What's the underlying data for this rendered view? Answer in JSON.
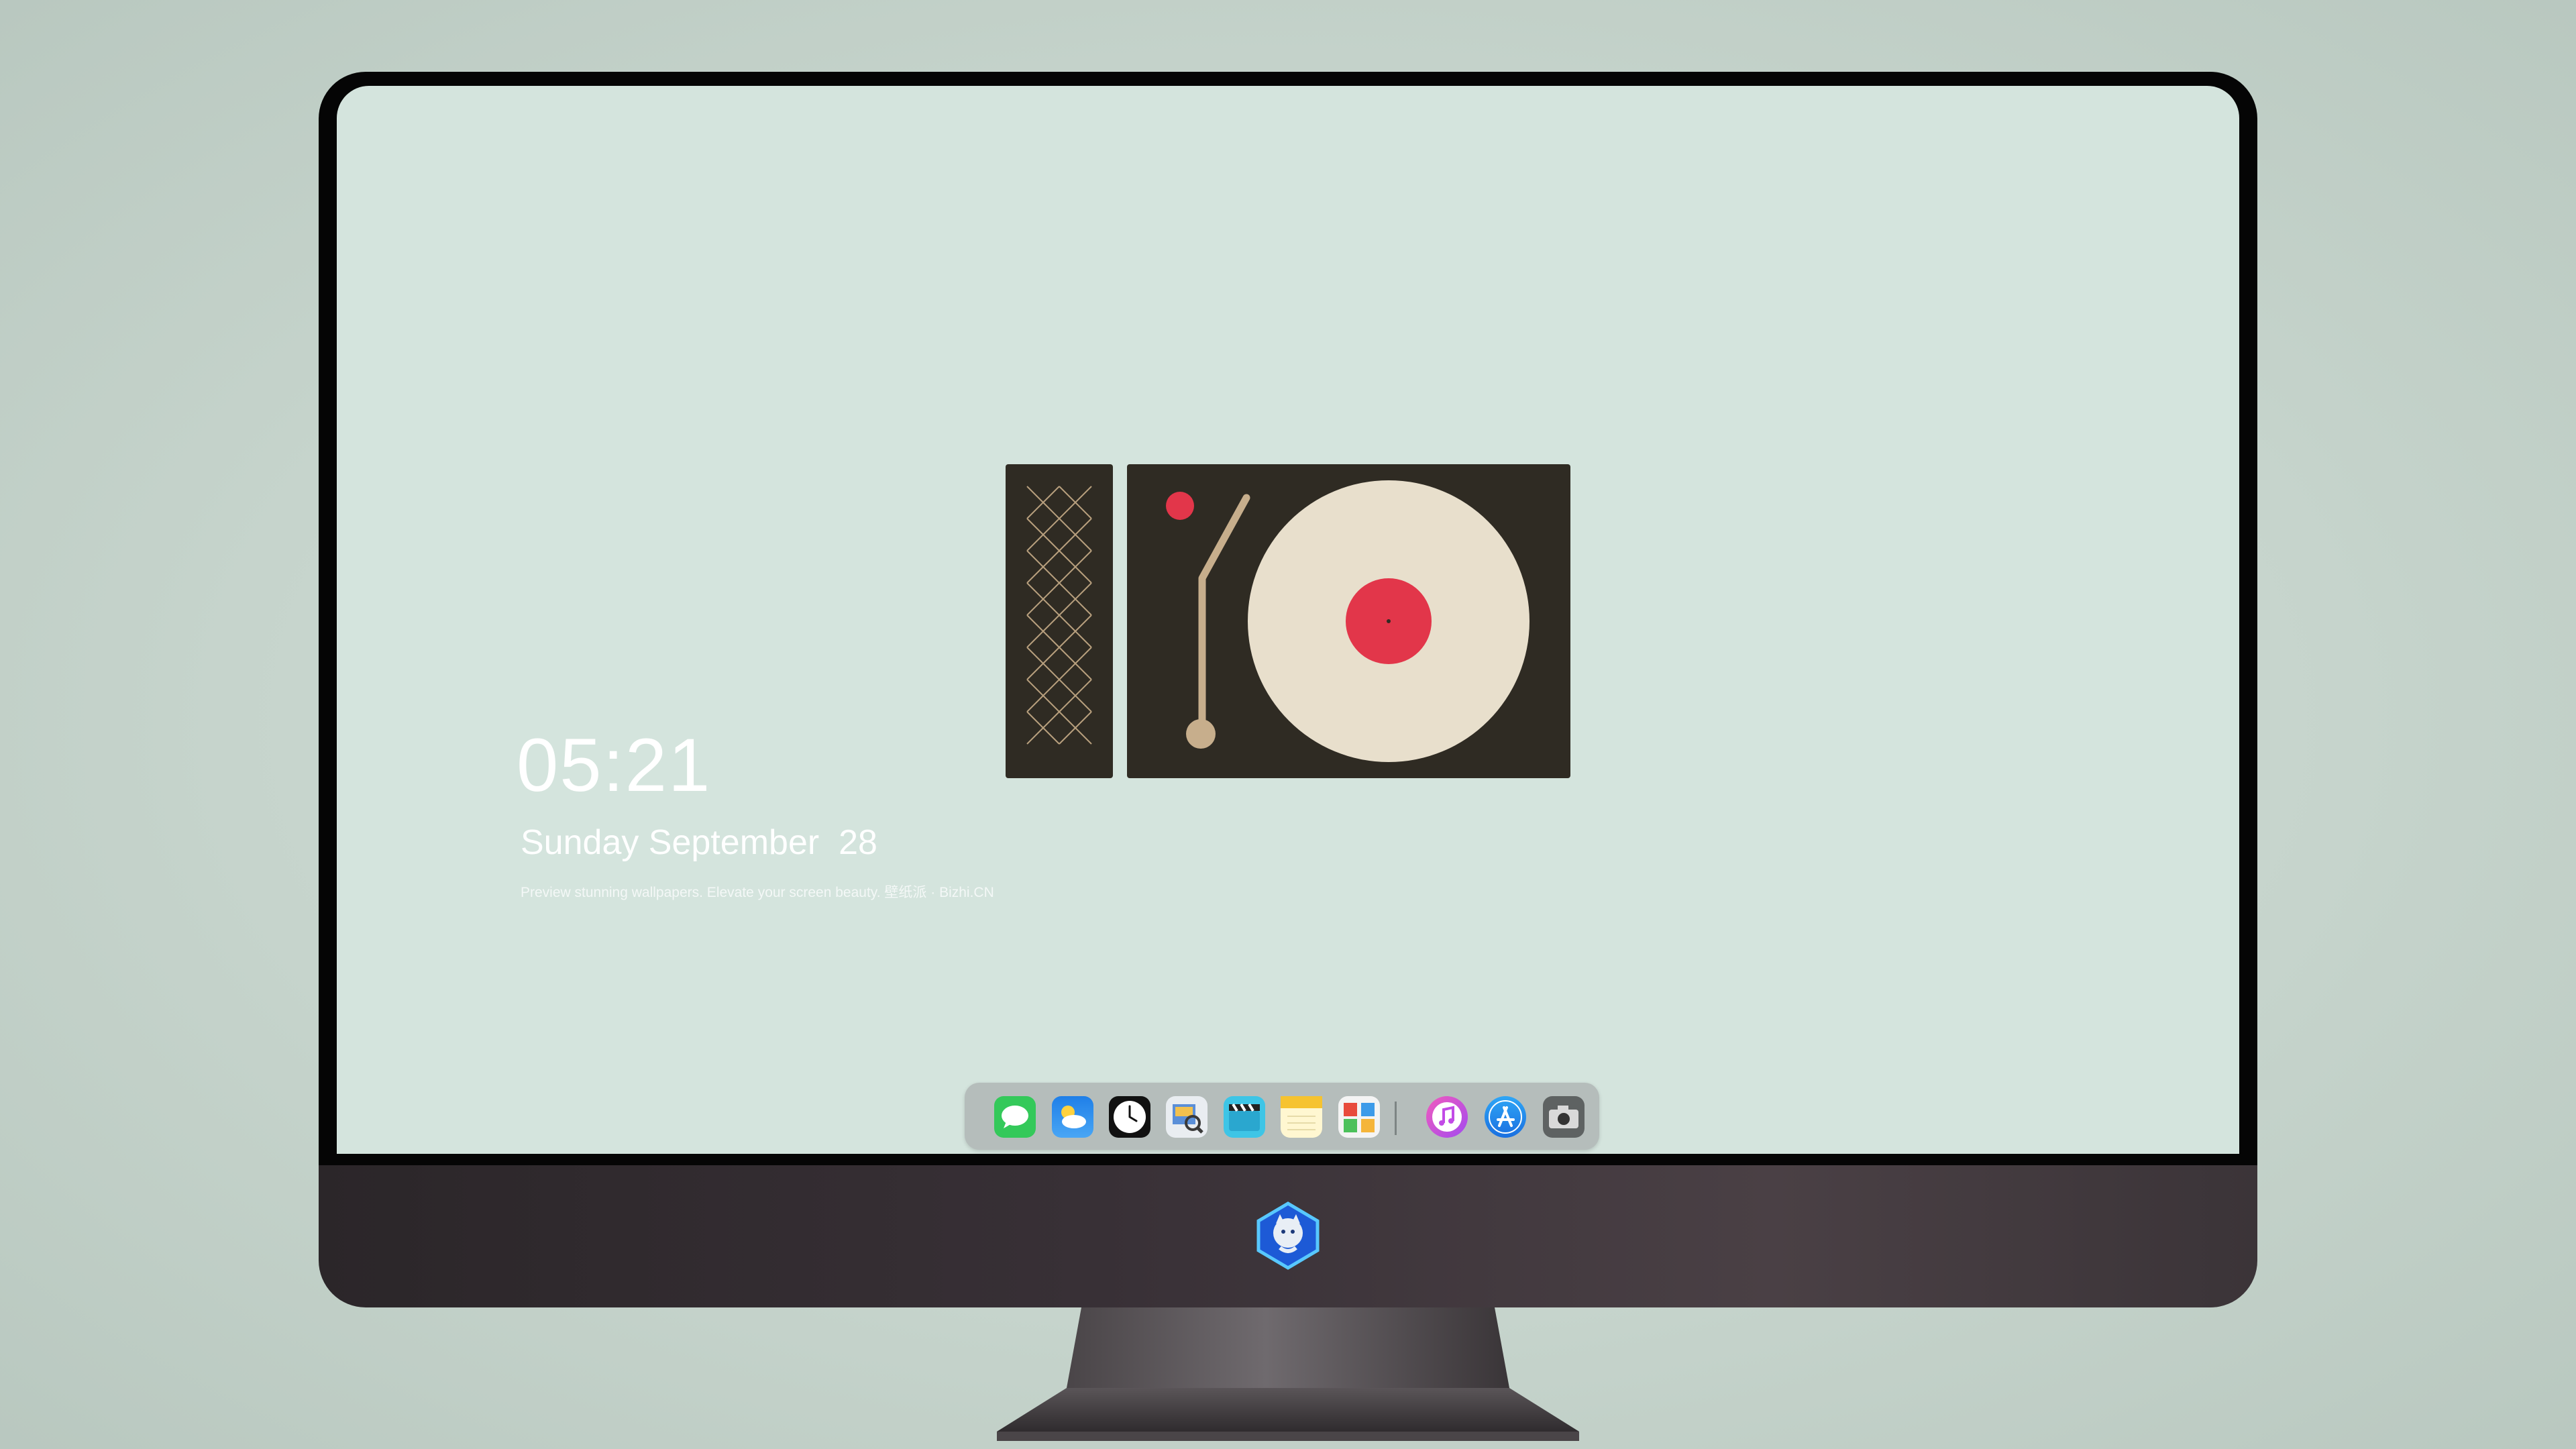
{
  "lockscreen": {
    "time": "05:21",
    "date": "Sunday September  28",
    "caption": "Preview stunning wallpapers. Elevate your screen beauty. 壁纸派 · Bizhi.CN"
  },
  "colors": {
    "background": "#c7d5cd",
    "screen": "#d4e4dd",
    "turntable_body": "#2f2b23",
    "record": "#e8dfcc",
    "record_label": "#e2364a",
    "tonearm": "#c7ae8c",
    "dock": "#b5bdbb"
  },
  "dock": {
    "apps": [
      {
        "name": "Messages",
        "icon": "messages-icon"
      },
      {
        "name": "Weather",
        "icon": "weather-icon"
      },
      {
        "name": "Clock",
        "icon": "clock-icon"
      },
      {
        "name": "Preview",
        "icon": "preview-icon"
      },
      {
        "name": "Clips",
        "icon": "clips-icon"
      },
      {
        "name": "Notes",
        "icon": "notes-icon"
      },
      {
        "name": "Photo Booth",
        "icon": "photo-booth-icon"
      },
      {
        "name": "iTunes",
        "icon": "itunes-icon"
      },
      {
        "name": "App Store",
        "icon": "app-store-icon"
      },
      {
        "name": "Camera",
        "icon": "camera-icon"
      }
    ]
  }
}
